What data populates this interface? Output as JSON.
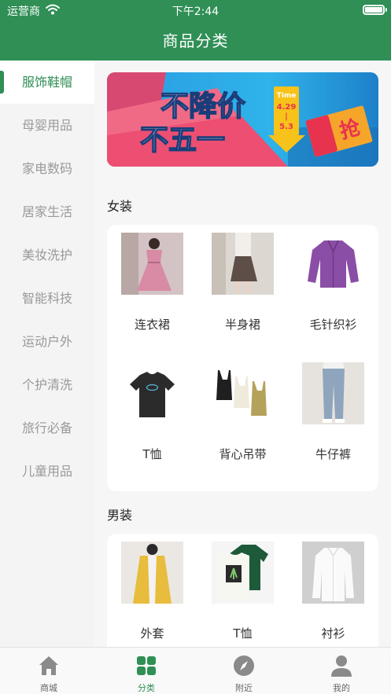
{
  "status_bar": {
    "carrier": "运营商",
    "time": "下午2:44"
  },
  "header": {
    "title": "商品分类"
  },
  "sidebar": {
    "items": [
      {
        "label": "服饰鞋帽",
        "active": true
      },
      {
        "label": "母婴用品"
      },
      {
        "label": "家电数码"
      },
      {
        "label": "居家生活"
      },
      {
        "label": "美妆洗护"
      },
      {
        "label": "智能科技"
      },
      {
        "label": "运动户外"
      },
      {
        "label": "个护清洗"
      },
      {
        "label": "旅行必备"
      },
      {
        "label": "儿童用品"
      }
    ]
  },
  "banner": {
    "line1": "不降价",
    "line2": "不五一",
    "time_label": "Time",
    "date_start": "4.29",
    "date_sep": "|",
    "date_end": "5.3",
    "tag": "抢"
  },
  "sections": [
    {
      "title": "女装",
      "items": [
        {
          "label": "连衣裙",
          "icon": "dress-photo"
        },
        {
          "label": "半身裙",
          "icon": "skirt-photo"
        },
        {
          "label": "毛针织衫",
          "icon": "cardigan-photo"
        },
        {
          "label": "T恤",
          "icon": "tshirt-photo"
        },
        {
          "label": "背心吊带",
          "icon": "camisole-photo"
        },
        {
          "label": "牛仔裤",
          "icon": "jeans-photo"
        }
      ]
    },
    {
      "title": "男装",
      "items": [
        {
          "label": "外套",
          "icon": "jacket-photo"
        },
        {
          "label": "T恤",
          "icon": "tshirt-photo"
        },
        {
          "label": "衬衫",
          "icon": "shirt-photo"
        }
      ]
    }
  ],
  "tabbar": {
    "items": [
      {
        "label": "商城",
        "icon": "home-icon"
      },
      {
        "label": "分类",
        "icon": "category-icon",
        "active": true
      },
      {
        "label": "附近",
        "icon": "compass-icon"
      },
      {
        "label": "我的",
        "icon": "user-icon"
      }
    ]
  },
  "colors": {
    "brand": "#2f8f55",
    "inactive_text": "#999999",
    "tab_icon_gray": "#8a8a8a"
  }
}
